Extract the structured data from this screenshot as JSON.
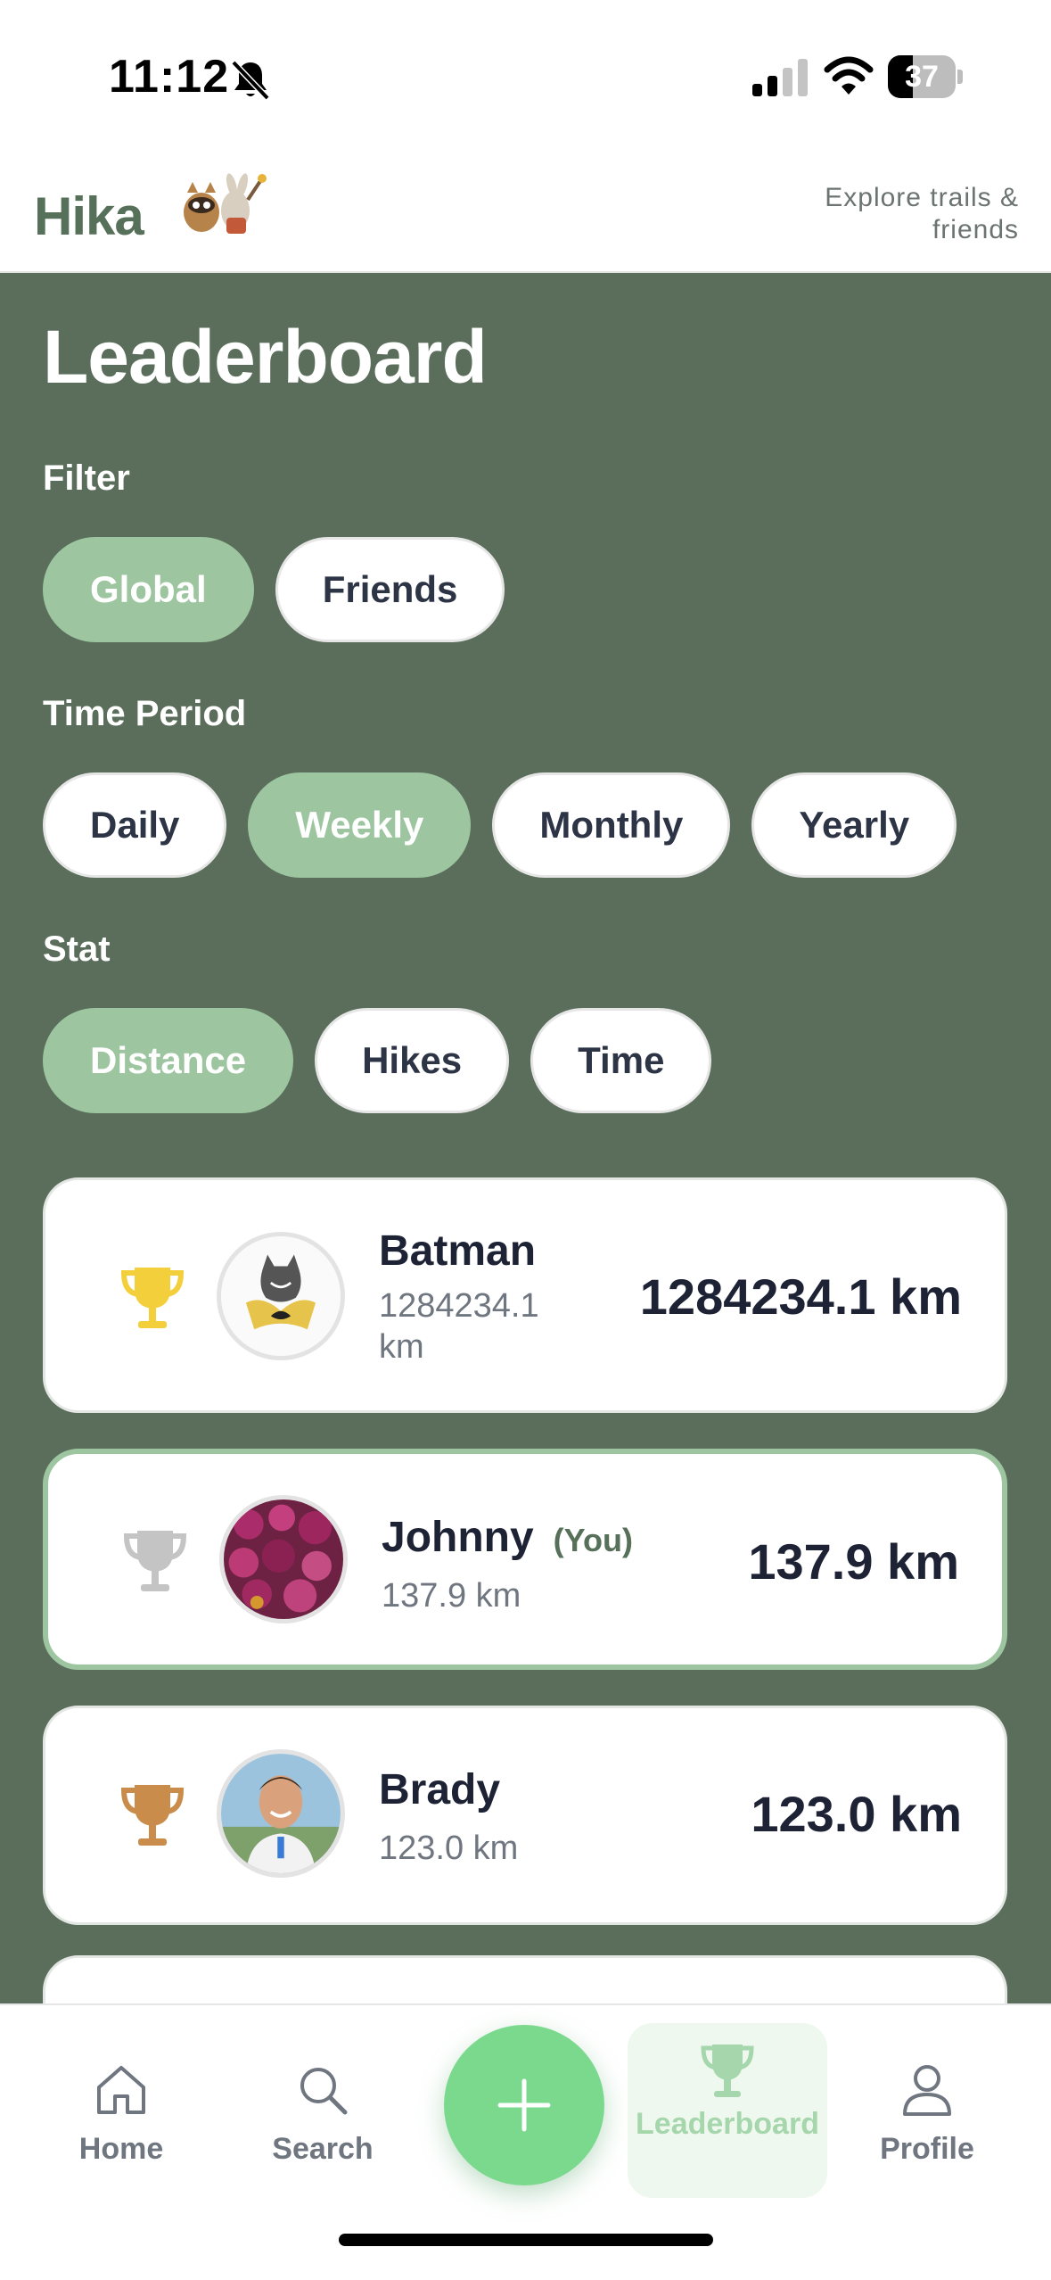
{
  "status_bar": {
    "time": "11:12",
    "battery_level": "37",
    "battery_fraction": 0.37
  },
  "header": {
    "brand": "Hika",
    "tagline_line1": "Explore trails &",
    "tagline_line2": "friends"
  },
  "leaderboard": {
    "title": "Leaderboard",
    "filter": {
      "label": "Filter",
      "options": [
        "Global",
        "Friends"
      ],
      "selected": "Global"
    },
    "time_period": {
      "label": "Time Period",
      "options": [
        "Daily",
        "Weekly",
        "Monthly",
        "Yearly"
      ],
      "selected": "Weekly"
    },
    "stat": {
      "label": "Stat",
      "options": [
        "Distance",
        "Hikes",
        "Time"
      ],
      "selected": "Distance"
    },
    "entries": [
      {
        "rank_trophy": "gold-trophy-icon",
        "name": "Batman",
        "sub_line1": "1284234.1",
        "sub_line2": "km",
        "value": "1284234.1 km",
        "you": false
      },
      {
        "rank_trophy": "silver-trophy-icon",
        "name": "Johnny",
        "you_label": "(You)",
        "sub": "137.9 km",
        "value": "137.9 km",
        "you": true
      },
      {
        "rank_trophy": "bronze-trophy-icon",
        "name": "Brady",
        "sub": "123.0 km",
        "value": "123.0 km",
        "you": false
      }
    ]
  },
  "bottom_nav": {
    "items": [
      {
        "label": "Home",
        "icon": "home-icon"
      },
      {
        "label": "Search",
        "icon": "search-icon"
      },
      {
        "label": "Leaderboard",
        "icon": "trophy-icon",
        "active": true
      },
      {
        "label": "Profile",
        "icon": "person-icon"
      }
    ],
    "fab_icon": "plus-icon"
  },
  "colors": {
    "main_background": "#5a6e5b",
    "chip_active": "#9dc6a0",
    "brand": "#56705a",
    "fab": "#7bd98d",
    "gold": "#f2cf3b",
    "silver": "#c4c4c4",
    "bronze": "#c98c4a"
  }
}
